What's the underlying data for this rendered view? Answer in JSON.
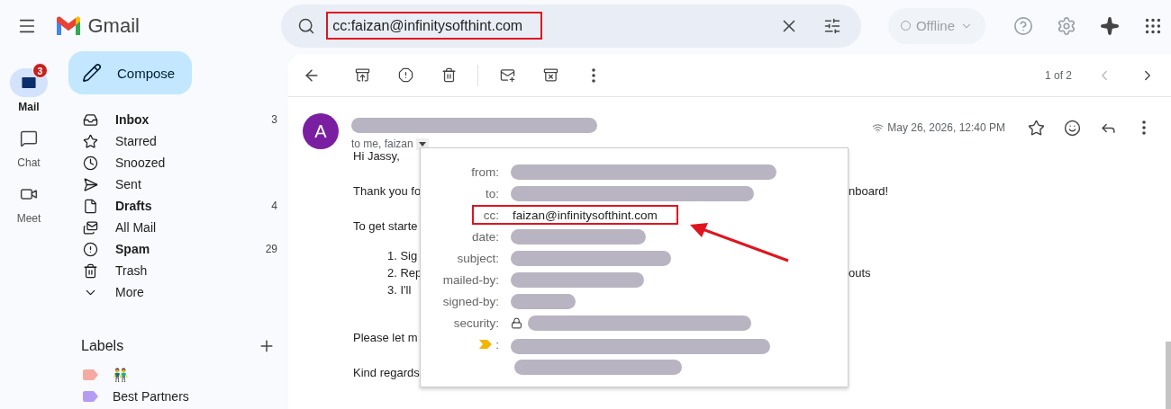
{
  "header": {
    "app_name": "Gmail",
    "search": {
      "value": "cc:faizan@infinitysofthint.com",
      "highlighted": true
    },
    "status": "Offline"
  },
  "rail": [
    {
      "label": "Mail",
      "selected": true,
      "badge": "3"
    },
    {
      "label": "Chat",
      "selected": false
    },
    {
      "label": "Meet",
      "selected": false
    }
  ],
  "sidebar": {
    "compose": "Compose",
    "folders": [
      {
        "label": "Inbox",
        "count": "3",
        "unread": true
      },
      {
        "label": "Starred",
        "unread": false
      },
      {
        "label": "Snoozed",
        "unread": false
      },
      {
        "label": "Sent",
        "unread": false
      },
      {
        "label": "Drafts",
        "count": "4",
        "unread": true
      },
      {
        "label": "All Mail",
        "unread": false
      },
      {
        "label": "Spam",
        "count": "29",
        "unread": true
      },
      {
        "label": "Trash",
        "unread": false
      },
      {
        "label": "More",
        "unread": false
      }
    ],
    "labels": {
      "title": "Labels",
      "items": [
        {
          "label": "👬",
          "color": "#f4aaa2"
        },
        {
          "label": "Best Partners",
          "color": "#b59cf3"
        }
      ]
    }
  },
  "toolbar": {
    "pagination": "1 of 2"
  },
  "message": {
    "avatar": "A",
    "recipients": "to me, faizan",
    "date": "May 26, 2026, 12:40 PM",
    "body": [
      {
        "kind": "para",
        "text": "Hi Jassy,"
      },
      {
        "kind": "para",
        "text": "Thank you fo",
        "right": "nboard!"
      },
      {
        "kind": "para",
        "text": "To get starte"
      },
      {
        "kind": "list",
        "text": "1. Sig"
      },
      {
        "kind": "list",
        "text": "2. Rep",
        "right": "outs"
      },
      {
        "kind": "list",
        "text": "3. I'll"
      },
      {
        "kind": "para",
        "text": "Please let m"
      },
      {
        "kind": "para",
        "text": "Kind regards"
      }
    ],
    "details": [
      {
        "kind": "hidden",
        "label": "from:"
      },
      {
        "kind": "hidden",
        "label": "to:"
      },
      {
        "kind": "text",
        "label": "cc:",
        "value": "faizan@infinitysofthint.com",
        "highlighted": true
      },
      {
        "kind": "hidden",
        "label": "date:"
      },
      {
        "kind": "hidden",
        "label": "subject:"
      },
      {
        "kind": "hidden",
        "label": "mailed-by:"
      },
      {
        "kind": "hidden",
        "label": "signed-by:"
      },
      {
        "kind": "security",
        "label": "security:"
      },
      {
        "kind": "importance",
        "label": ":"
      }
    ]
  }
}
